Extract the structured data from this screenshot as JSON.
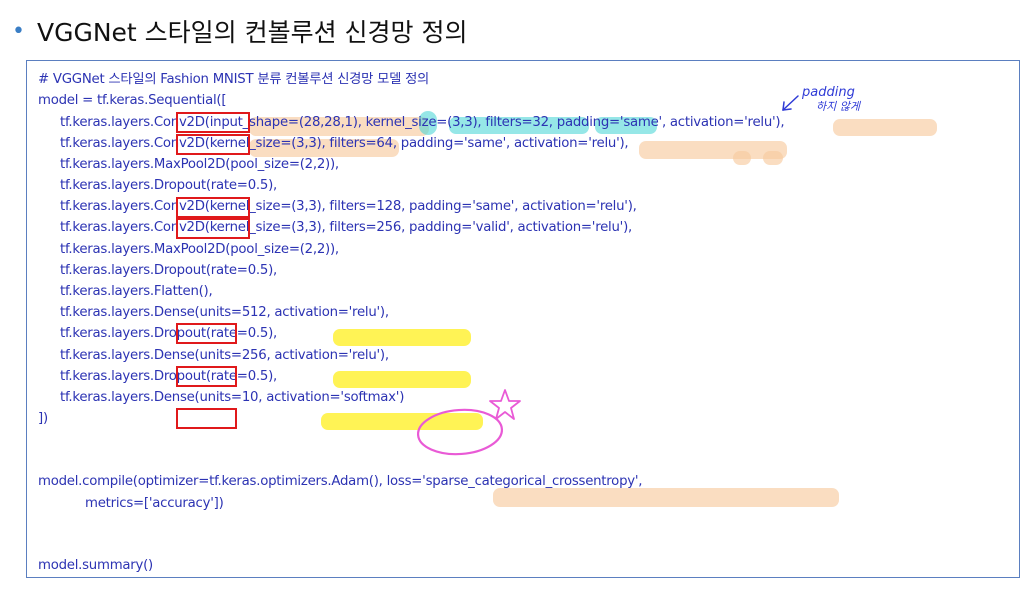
{
  "slide": {
    "title": "VGGNet 스타일의 컨볼루션 신경망 정의",
    "bullet_color": "#3a7ec5"
  },
  "code": {
    "comment": "# VGGNet 스타일의 Fashion MNIST 분류 컨볼루션 신경망 모델 정의",
    "lines": {
      "l1": "model = tf.keras.Sequential([",
      "l2": "tf.keras.layers.Conv2D(input_shape=(28,28,1), kernel_size=(3,3), filters=32, padding='same', activation='relu'),",
      "l3": "tf.keras.layers.Conv2D(kernel_size=(3,3), filters=64, padding='same', activation='relu'),",
      "l4": "tf.keras.layers.MaxPool2D(pool_size=(2,2)),",
      "l5": "tf.keras.layers.Dropout(rate=0.5),",
      "l6": "tf.keras.layers.Conv2D(kernel_size=(3,3), filters=128, padding='same', activation='relu'),",
      "l7": "tf.keras.layers.Conv2D(kernel_size=(3,3), filters=256, padding='valid', activation='relu'),",
      "l8": "tf.keras.layers.MaxPool2D(pool_size=(2,2)),",
      "l9": "tf.keras.layers.Dropout(rate=0.5),",
      "l10": "tf.keras.layers.Flatten(),",
      "l11": "tf.keras.layers.Dense(units=512, activation='relu'),",
      "l12": "tf.keras.layers.Dropout(rate=0.5),",
      "l13": "tf.keras.layers.Dense(units=256, activation='relu'),",
      "l14": "tf.keras.layers.Dropout(rate=0.5),",
      "l15": "tf.keras.layers.Dense(units=10, activation='softmax')",
      "l16": "])",
      "l17": "model.compile(optimizer=tf.keras.optimizers.Adam(), loss='sparse_categorical_crossentropy',",
      "l18": "metrics=['accuracy'])",
      "l19": "model.summary()"
    },
    "text_color": "#2c33b3",
    "border_color": "#5b7fc0"
  },
  "annotations": {
    "handwritten_note_line1": "padding",
    "handwritten_note_line2": "하지 않게",
    "colors": {
      "red_box": "#e0191b",
      "orange_highlight": "#f8cba0",
      "cyan_highlight": "#50d7d7",
      "yellow_highlight": "#ffee14",
      "pink_circle": "#e95ad6",
      "ink": "#2f3bd6"
    }
  }
}
